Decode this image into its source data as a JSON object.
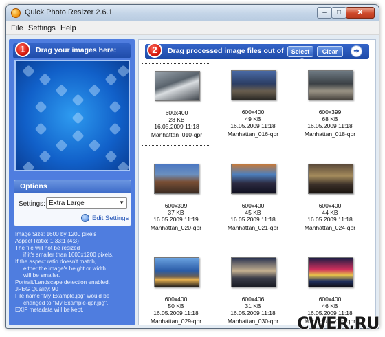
{
  "window": {
    "title": "Quick Photo Resizer 2.6.1",
    "min": "–",
    "max": "□",
    "close": "✕"
  },
  "menu": [
    "File",
    "Settings",
    "Help"
  ],
  "step1": {
    "num": "1",
    "label": "Drag your images here:"
  },
  "step2": {
    "num": "2",
    "label": "Drag processed image files out of",
    "select_all": "Select all",
    "clear": "Clear",
    "arrow": "➜"
  },
  "options": {
    "title": "Options",
    "settings_label": "Settings:",
    "settings_value": "Extra Large",
    "edit_settings": "Edit Settings"
  },
  "info_lines": [
    "Image Size: 1600 by 1200 pixels",
    "Aspect Ratio: 1.33:1 (4:3)",
    "The file will not be resized",
    "if it's smaller than 1600x1200 pixels.",
    "If the aspect ratio doesn't match,",
    "either the image's height or width",
    "will be smaller.",
    "Portrait/Landscape detection enabled.",
    "JPEG Quality: 90",
    "File name \"My Example.jpg\" would be",
    "changed to \"My Example-qpr.jpg\".",
    "EXIF metadata will be kept."
  ],
  "images": [
    {
      "dims": "600x400",
      "size": "28 KB",
      "date": "16.05.2009 11:18",
      "name": "Manhattan_010-qpr"
    },
    {
      "dims": "600x400",
      "size": "49 KB",
      "date": "16.05.2009 11:18",
      "name": "Manhattan_016-qpr"
    },
    {
      "dims": "600x399",
      "size": "68 KB",
      "date": "16.05.2009 11:18",
      "name": "Manhattan_018-qpr"
    },
    {
      "dims": "600x399",
      "size": "37 KB",
      "date": "16.05.2009 11:19",
      "name": "Manhattan_020-qpr"
    },
    {
      "dims": "600x400",
      "size": "45 KB",
      "date": "16.05.2009 11:18",
      "name": "Manhattan_021-qpr"
    },
    {
      "dims": "600x400",
      "size": "44 KB",
      "date": "16.05.2009 11:18",
      "name": "Manhattan_024-qpr"
    },
    {
      "dims": "600x400",
      "size": "50 KB",
      "date": "16.05.2009 11:18",
      "name": "Manhattan_029-qpr"
    },
    {
      "dims": "600x406",
      "size": "31 KB",
      "date": "16.05.2009 11:18",
      "name": "Manhattan_030-qpr"
    },
    {
      "dims": "600x400",
      "size": "46 KB",
      "date": "16.05.2009 11:18",
      "name": "Manhattan_034-qpr"
    }
  ],
  "watermark": "CWER.RU"
}
